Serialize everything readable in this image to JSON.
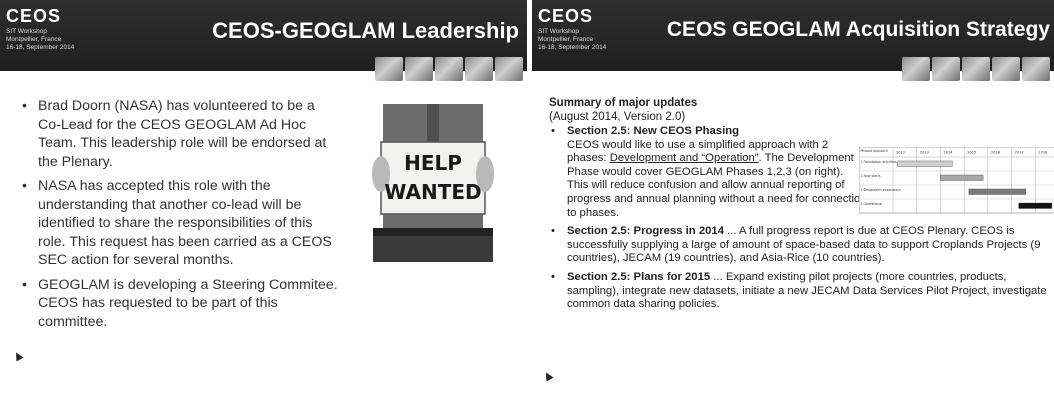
{
  "left": {
    "logo": "CEOS",
    "workshop": [
      "SIT Workshop",
      "Montpellier, France",
      "16-18, September 2014"
    ],
    "title": "CEOS-GEOGLAM Leadership",
    "bullets": [
      "Brad Doorn (NASA) has volunteered to be a Co-Lead for the CEOS GEOGLAM Ad Hoc Team.  This leadership role will be endorsed at the Plenary.",
      "NASA has accepted this role with the understanding that another co-lead will be identified to share the responsibilities of this role.  This request has been carried as a CEOS SEC action for several months.",
      "GEOGLAM is developing a Steering Commitee.  CEOS has requested to be part of this committee."
    ],
    "sign_line1": "HELP",
    "sign_line2": "WANTED"
  },
  "right": {
    "logo": "CEOS",
    "workshop": [
      "SIT Workshop",
      "Montpellier, France",
      "16-18, September 2014"
    ],
    "title": "CEOS GEOGLAM Acquisition Strategy",
    "summary_heading": "Summary of major updates",
    "summary_sub": "(August 2014, Version 2.0)",
    "sections": [
      {
        "heading": "Section 2.5: New CEOS Phasing",
        "text_before": "CEOS would like to use a simplified approach with 2 phases: ",
        "underlined": "Development and “Operation”",
        "text_after": ". The Development Phase would cover GEOGLAM Phases 1,2,3 (on right).  This will reduce confusion and allow annual reporting of progress and annual planning without a need for connection to phases."
      },
      {
        "heading": "Section 2.5: Progress in 2014",
        "text": " ... A full progress report is due at CEOS Plenary. CEOS is successfully supplying a large of amount of space-based data to support Croplands Projects (9 countries), JECAM (19 countries), and Asia-Rice (10 countries)."
      },
      {
        "heading": "Section 2.5: Plans for 2015",
        "text": " ... Expand existing pilot projects (more countries, products, sampling), integrate new datasets, initiate a new JECAM Data Services Pilot Project, investigate common data sharing policies."
      }
    ],
    "gantt": {
      "corner": "Phased approach",
      "years": [
        "2012",
        "2013",
        "2014",
        "2015",
        "2016",
        "2017",
        "2018"
      ],
      "rows": [
        {
          "label": "1 Foundation activities",
          "start": 2012.2,
          "end": 2014.5,
          "color": "#cfcfcf"
        },
        {
          "label": "2 New starts",
          "start": 2014.0,
          "end": 2015.8,
          "color": "#a8a8a8"
        },
        {
          "label": "3 Geographic expansions",
          "start": 2015.2,
          "end": 2017.6,
          "color": "#7a7a7a"
        },
        {
          "label": "4 Operational",
          "start": 2017.3,
          "end": 2018.7,
          "color": "#111111"
        }
      ]
    }
  }
}
